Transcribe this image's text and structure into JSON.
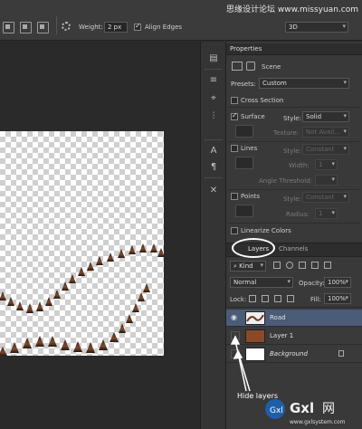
{
  "watermark": "思缘设计论坛 www.missyuan.com",
  "options_bar": {
    "weight_label": "Weight:",
    "weight_value": "2 px",
    "align_edges_label": "Align Edges",
    "align_edges_checked": true,
    "mode_value": "3D"
  },
  "properties": {
    "tab_label": "Properties",
    "scene_label": "Scene",
    "presets_label": "Presets:",
    "presets_value": "Custom",
    "cross_section_label": "Cross Section",
    "surface_label": "Surface",
    "surface_style_label": "Style:",
    "surface_style_value": "Solid",
    "texture_label": "Texture:",
    "texture_value": "Not Avail...",
    "lines_label": "Lines",
    "lines_style_label": "Style:",
    "lines_style_value": "Constant",
    "width_label": "Width:",
    "width_value": "1",
    "angle_label": "Angle Threshold:",
    "points_label": "Points",
    "points_style_label": "Style:",
    "points_style_value": "Constant",
    "radius_label": "Radius:",
    "radius_value": "1",
    "linearize_label": "Linearize Colors"
  },
  "layers_panel": {
    "tab_layers": "Layers",
    "tab_channels": "Channels",
    "kind_label": "Kind",
    "blend_mode": "Normal",
    "opacity_label": "Opacity:",
    "opacity_value": "100%",
    "lock_label": "Lock:",
    "fill_label": "Fill:",
    "fill_value": "100%",
    "layers": [
      {
        "name": "Road",
        "visible": true,
        "selected": true
      },
      {
        "name": "Layer 1",
        "visible": false,
        "selected": false
      },
      {
        "name": "Background",
        "visible": false,
        "selected": false
      }
    ]
  },
  "annotation": "Hide layers",
  "logo": {
    "brand": "Gxl",
    "net": "网",
    "url": "www.gxlsystem.com"
  }
}
